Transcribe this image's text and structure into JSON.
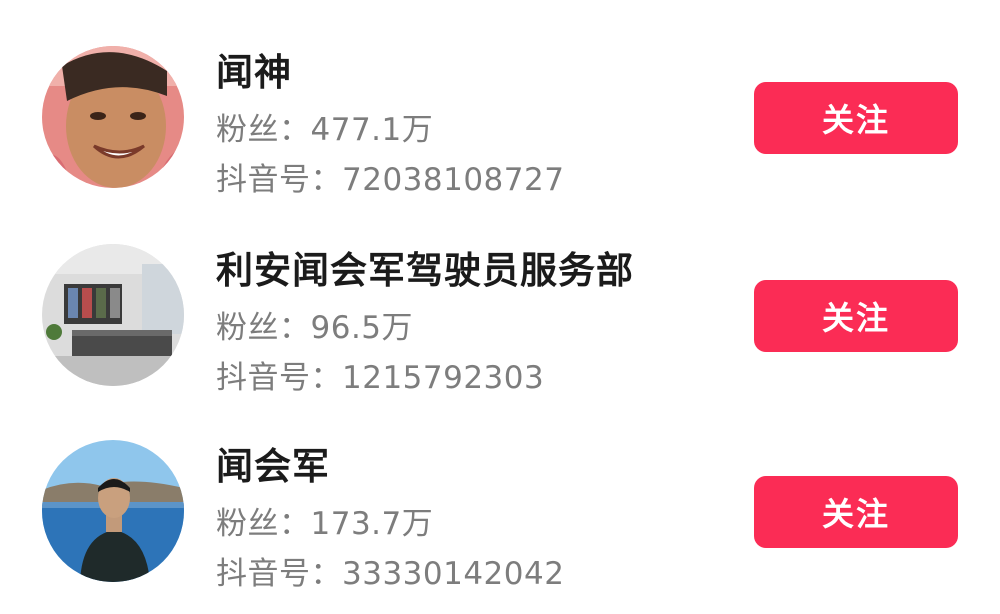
{
  "accent_color": "#fb2c55",
  "accounts": [
    {
      "name": "闻神",
      "fans_label": "粉丝：",
      "fans_value": "477.1万",
      "douyin_label": "抖音号：",
      "douyin_id": "72038108727",
      "follow_label": "关注",
      "avatar_icon": "avatar-woman-smiling"
    },
    {
      "name": "利安闻会军驾驶员服务部",
      "fans_label": "粉丝：",
      "fans_value": "96.5万",
      "douyin_label": "抖音号：",
      "douyin_id": "1215792303",
      "follow_label": "关注",
      "avatar_icon": "avatar-office-interior"
    },
    {
      "name": "闻会军",
      "fans_label": "粉丝：",
      "fans_value": "173.7万",
      "douyin_label": "抖音号：",
      "douyin_id": "33330142042",
      "follow_label": "关注",
      "avatar_icon": "avatar-man-by-lake"
    }
  ]
}
